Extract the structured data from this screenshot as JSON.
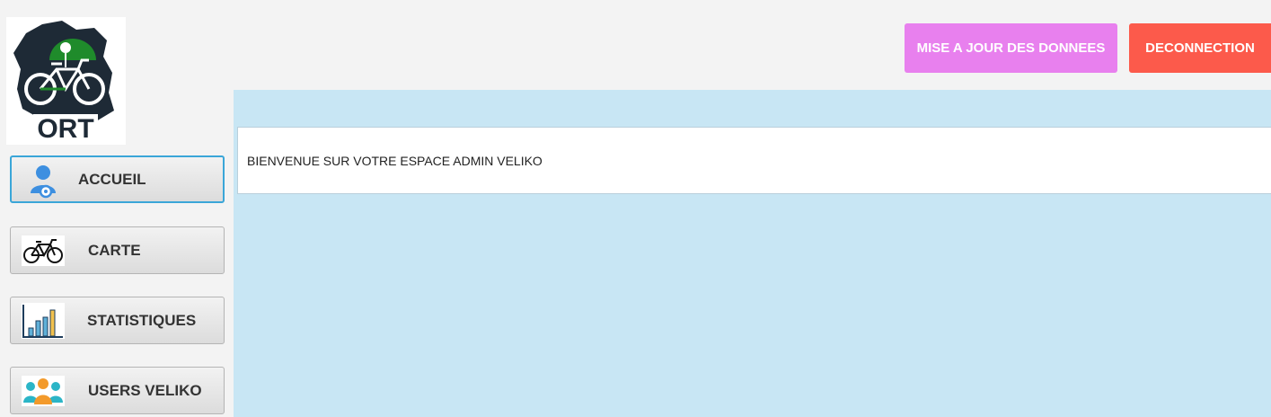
{
  "logo": {
    "text": "ORT"
  },
  "header": {
    "update_label": "MISE A JOUR DES DONNEES",
    "logout_label": "DECONNECTION"
  },
  "main": {
    "welcome_text": "BIENVENUE SUR VOTRE ESPACE ADMIN VELIKO"
  },
  "sidebar": {
    "items": [
      {
        "label": "ACCUEIL",
        "icon": "user-gear-icon",
        "active": true
      },
      {
        "label": "CARTE",
        "icon": "bicycle-icon",
        "active": false
      },
      {
        "label": "STATISTIQUES",
        "icon": "bar-chart-icon",
        "active": false
      },
      {
        "label": "USERS VELIKO",
        "icon": "users-group-icon",
        "active": false
      }
    ]
  },
  "colors": {
    "update_button": "#e880ee",
    "logout_button": "#fc5a4b",
    "main_background": "#c8e6f4",
    "active_border": "#3aa6d8"
  }
}
